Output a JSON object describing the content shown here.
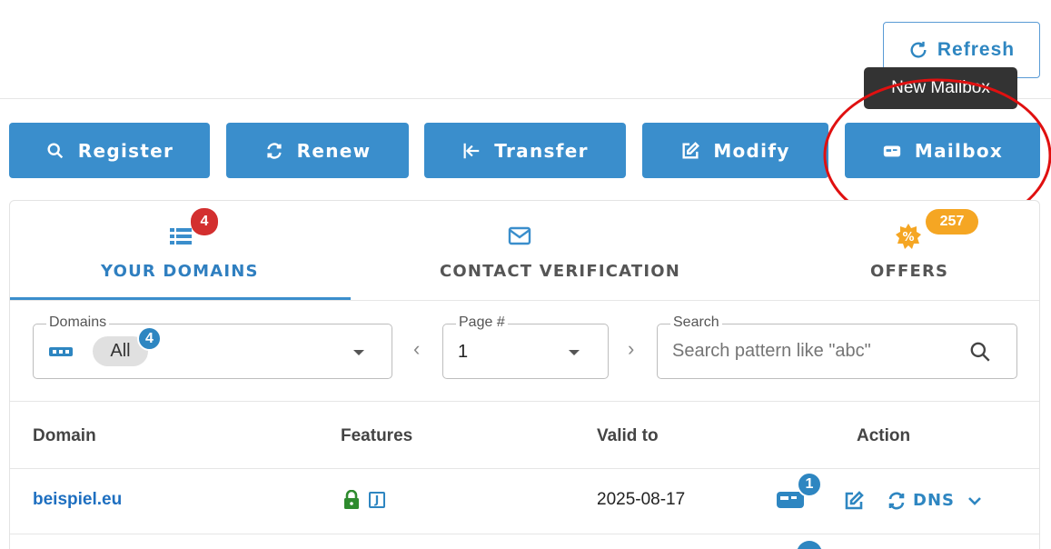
{
  "header": {
    "refresh_label": "Refresh",
    "tooltip_text": "New Mailbox"
  },
  "actions": [
    {
      "label": "Register",
      "icon": "search-icon"
    },
    {
      "label": "Renew",
      "icon": "renew-icon"
    },
    {
      "label": "Transfer",
      "icon": "transfer-icon"
    },
    {
      "label": "Modify",
      "icon": "edit-icon"
    },
    {
      "label": "Mailbox",
      "icon": "mailbox-icon"
    }
  ],
  "tabs": [
    {
      "label": "YOUR DOMAINS",
      "badge": "4",
      "icon": "list-icon",
      "active": true
    },
    {
      "label": "CONTACT VERIFICATION",
      "icon": "mail-icon",
      "active": false
    },
    {
      "label": "OFFERS",
      "badge": "257",
      "icon": "discount-icon",
      "active": false
    }
  ],
  "filters": {
    "domains": {
      "legend": "Domains",
      "chip": "All",
      "badge": "4"
    },
    "page": {
      "legend": "Page #",
      "value": "1"
    },
    "search": {
      "legend": "Search",
      "placeholder": "Search pattern like \"abc\""
    }
  },
  "table": {
    "headers": [
      "Domain",
      "Features",
      "Valid to",
      "Action"
    ],
    "rows": [
      {
        "domain": "beispiel.eu",
        "valid_to": "2025-08-17",
        "mailbox_badge": "1",
        "dns_label": "DNS",
        "feature_letter": "J"
      }
    ]
  },
  "colors": {
    "primary": "#3a8ecc",
    "link": "#1e6fc0",
    "badge_red": "#d32f2f",
    "badge_orange": "#f5a623",
    "lock_green": "#2e8b2e",
    "annotation_red": "#e01010"
  }
}
